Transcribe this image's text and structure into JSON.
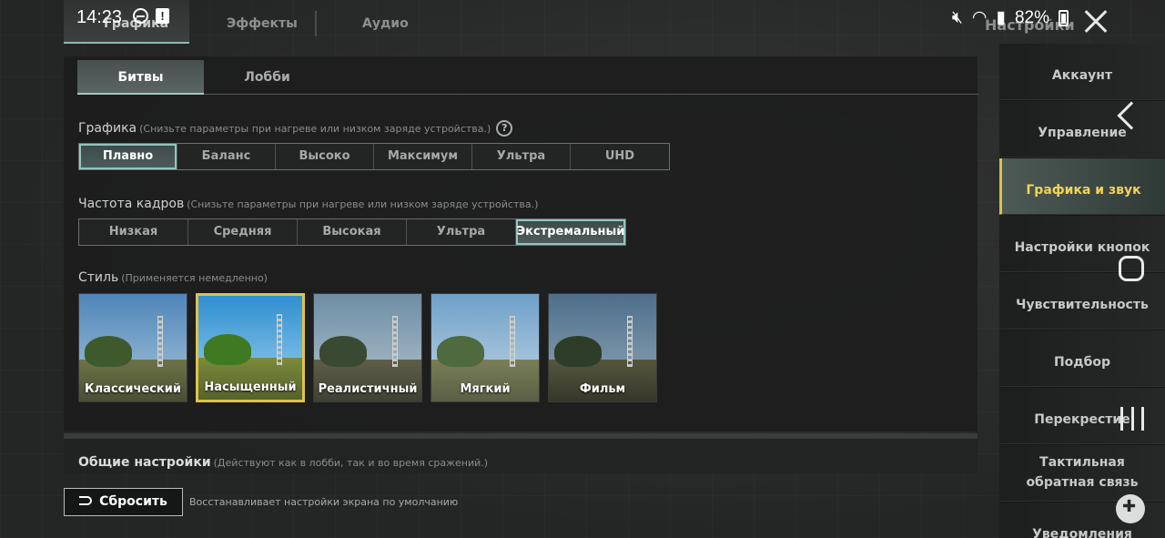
{
  "status_bar": {
    "time": "14:23",
    "battery": "82%"
  },
  "top_tabs": {
    "graphics": "Графика",
    "effects": "Эффекты",
    "audio": "Аудио"
  },
  "settings_title": "Настройки",
  "sub_tabs": {
    "battles": "Битвы",
    "lobby": "Лобби"
  },
  "graphics_section": {
    "label": "Графика",
    "hint": "(Снизьте параметры при нагреве или низком заряде устройства.)",
    "help": "?",
    "options": [
      "Плавно",
      "Баланс",
      "Высоко",
      "Максимум",
      "Ультра",
      "UHD"
    ],
    "selected": "Плавно"
  },
  "fps_section": {
    "label": "Частота кадров",
    "hint": "(Снизьте параметры при нагреве или низком заряде устройства.)",
    "options": [
      "Низкая",
      "Средняя",
      "Высокая",
      "Ультра",
      "Экстремальный"
    ],
    "selected": "Экстремальный"
  },
  "style_section": {
    "label": "Стиль",
    "hint": "(Применяется немедленно)",
    "options": [
      "Классический",
      "Насыщенный",
      "Реалистичный",
      "Мягкий",
      "Фильм"
    ],
    "selected": "Насыщенный"
  },
  "general_section": {
    "label": "Общие настройки",
    "hint": "(Действуют как в лобби, так и во время сражений.)"
  },
  "reset": {
    "label": "Сбросить",
    "description": "Восстанавливает настройки экрана по умолчанию"
  },
  "sidebar": {
    "items": [
      {
        "label": "Аккаунт"
      },
      {
        "label": "Управление"
      },
      {
        "label": "Графика и звук"
      },
      {
        "label": "Настройки кнопок"
      },
      {
        "label": "Чувствительность"
      },
      {
        "label": "Подбор"
      },
      {
        "label": "Перекрестие"
      },
      {
        "label": "Тактильная обратная связь"
      },
      {
        "label": "Уведомления"
      }
    ],
    "active_index": 2
  },
  "colors": {
    "accent_teal": "#93c4be",
    "selected_gold": "#e0c24a",
    "active_sidebar_text": "#f3d35a"
  }
}
